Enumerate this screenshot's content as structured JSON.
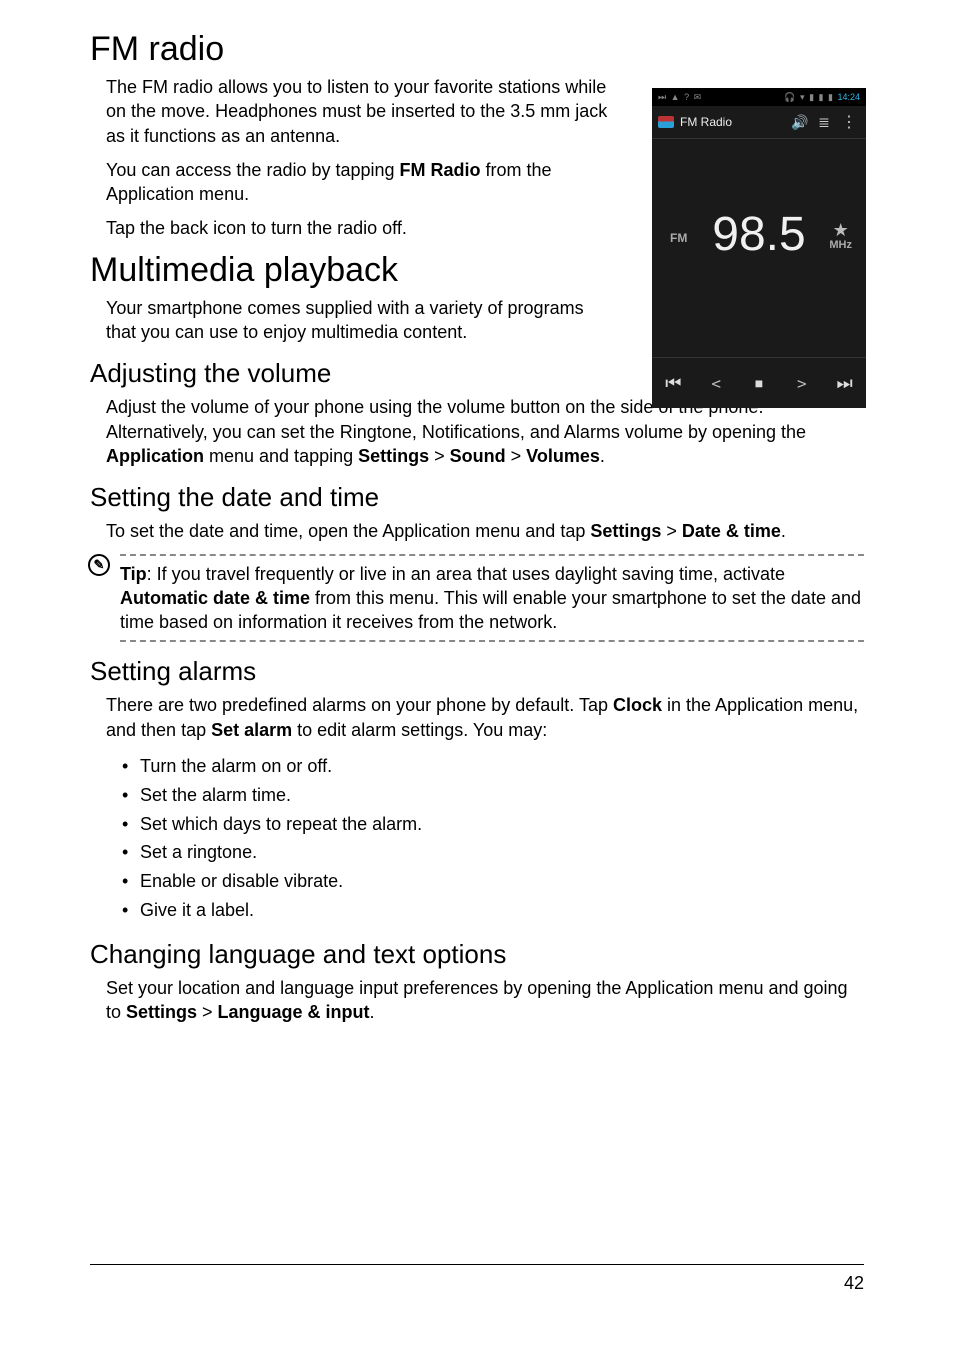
{
  "h1_fm": "FM radio",
  "fm_p1_a": "The FM radio allows you to listen to your favorite stations while on the move. Headphones must be inserted to the 3.5 mm jack as it functions as an antenna.",
  "fm_p2_a": "You can access the radio by tapping ",
  "fm_p2_b": "FM Radio",
  "fm_p2_c": " from the Application menu.",
  "fm_p3": "Tap the back icon to turn the radio off.",
  "h1_mm": "Multimedia playback",
  "mm_p1": "Your smartphone comes supplied with a variety of programs that you can use to enjoy multimedia content.",
  "h2_vol": "Adjusting the volume",
  "vol_p1_a": "Adjust the volume of your phone using the volume button on the side of the phone. Alternatively, you can set the Ringtone, Notifications, and Alarms volume by opening the ",
  "vol_p1_b": "Application",
  "vol_p1_c": " menu and tapping ",
  "vol_p1_d": "Settings",
  "gt": " > ",
  "vol_p1_e": "Sound",
  "vol_p1_f": "Volumes",
  "period": ".",
  "h2_dt": "Setting the date and time",
  "dt_p1_a": "To set the date and time, open the Application menu and tap ",
  "dt_p1_b": "Settings",
  "dt_p1_c": "Date & time",
  "tip_icon": "✎",
  "tip_a": "Tip",
  "tip_b": ": If you travel frequently or live in an area that uses daylight saving time, activate ",
  "tip_c": "Automatic date & time",
  "tip_d": " from this menu. This will enable your smartphone to set the date and time based on information it receives from the network.",
  "h2_al": "Setting alarms",
  "al_p1_a": "There are two predefined alarms on your phone by default. Tap ",
  "al_p1_b": "Clock",
  "al_p1_c": " in the Application menu, and then tap ",
  "al_p1_d": "Set alarm",
  "al_p1_e": " to edit alarm settings. You may:",
  "al_li1": "Turn the alarm on or off.",
  "al_li2": "Set the alarm time.",
  "al_li3": "Set which days to repeat the alarm.",
  "al_li4": "Set a ringtone.",
  "al_li5": "Enable or disable vibrate.",
  "al_li6": "Give it a label.",
  "h2_lang": "Changing language and text options",
  "lang_p1_a": "Set your location and language input preferences by opening the Application menu and going to ",
  "lang_p1_b": "Settings",
  "lang_p1_c": "Language & input",
  "page_no": "42",
  "phone": {
    "status_left": {
      "i1": "⏭",
      "i2": "▲",
      "i3": "?",
      "i4": "✉"
    },
    "status_right": {
      "i1": "🎧",
      "i2": "▾",
      "i3": "▮",
      "i4": "▮",
      "bat": "▮",
      "time": "14:24"
    },
    "app_title": "FM Radio",
    "t_speaker": "🔊",
    "t_list": "≣",
    "t_more": "⋮",
    "fm": "FM",
    "freq": "98.5",
    "star": "★",
    "mhz": "MHz",
    "c_prev": "⏮",
    "c_left": "<",
    "c_stop": "■",
    "c_right": ">",
    "c_next": "⏭"
  }
}
